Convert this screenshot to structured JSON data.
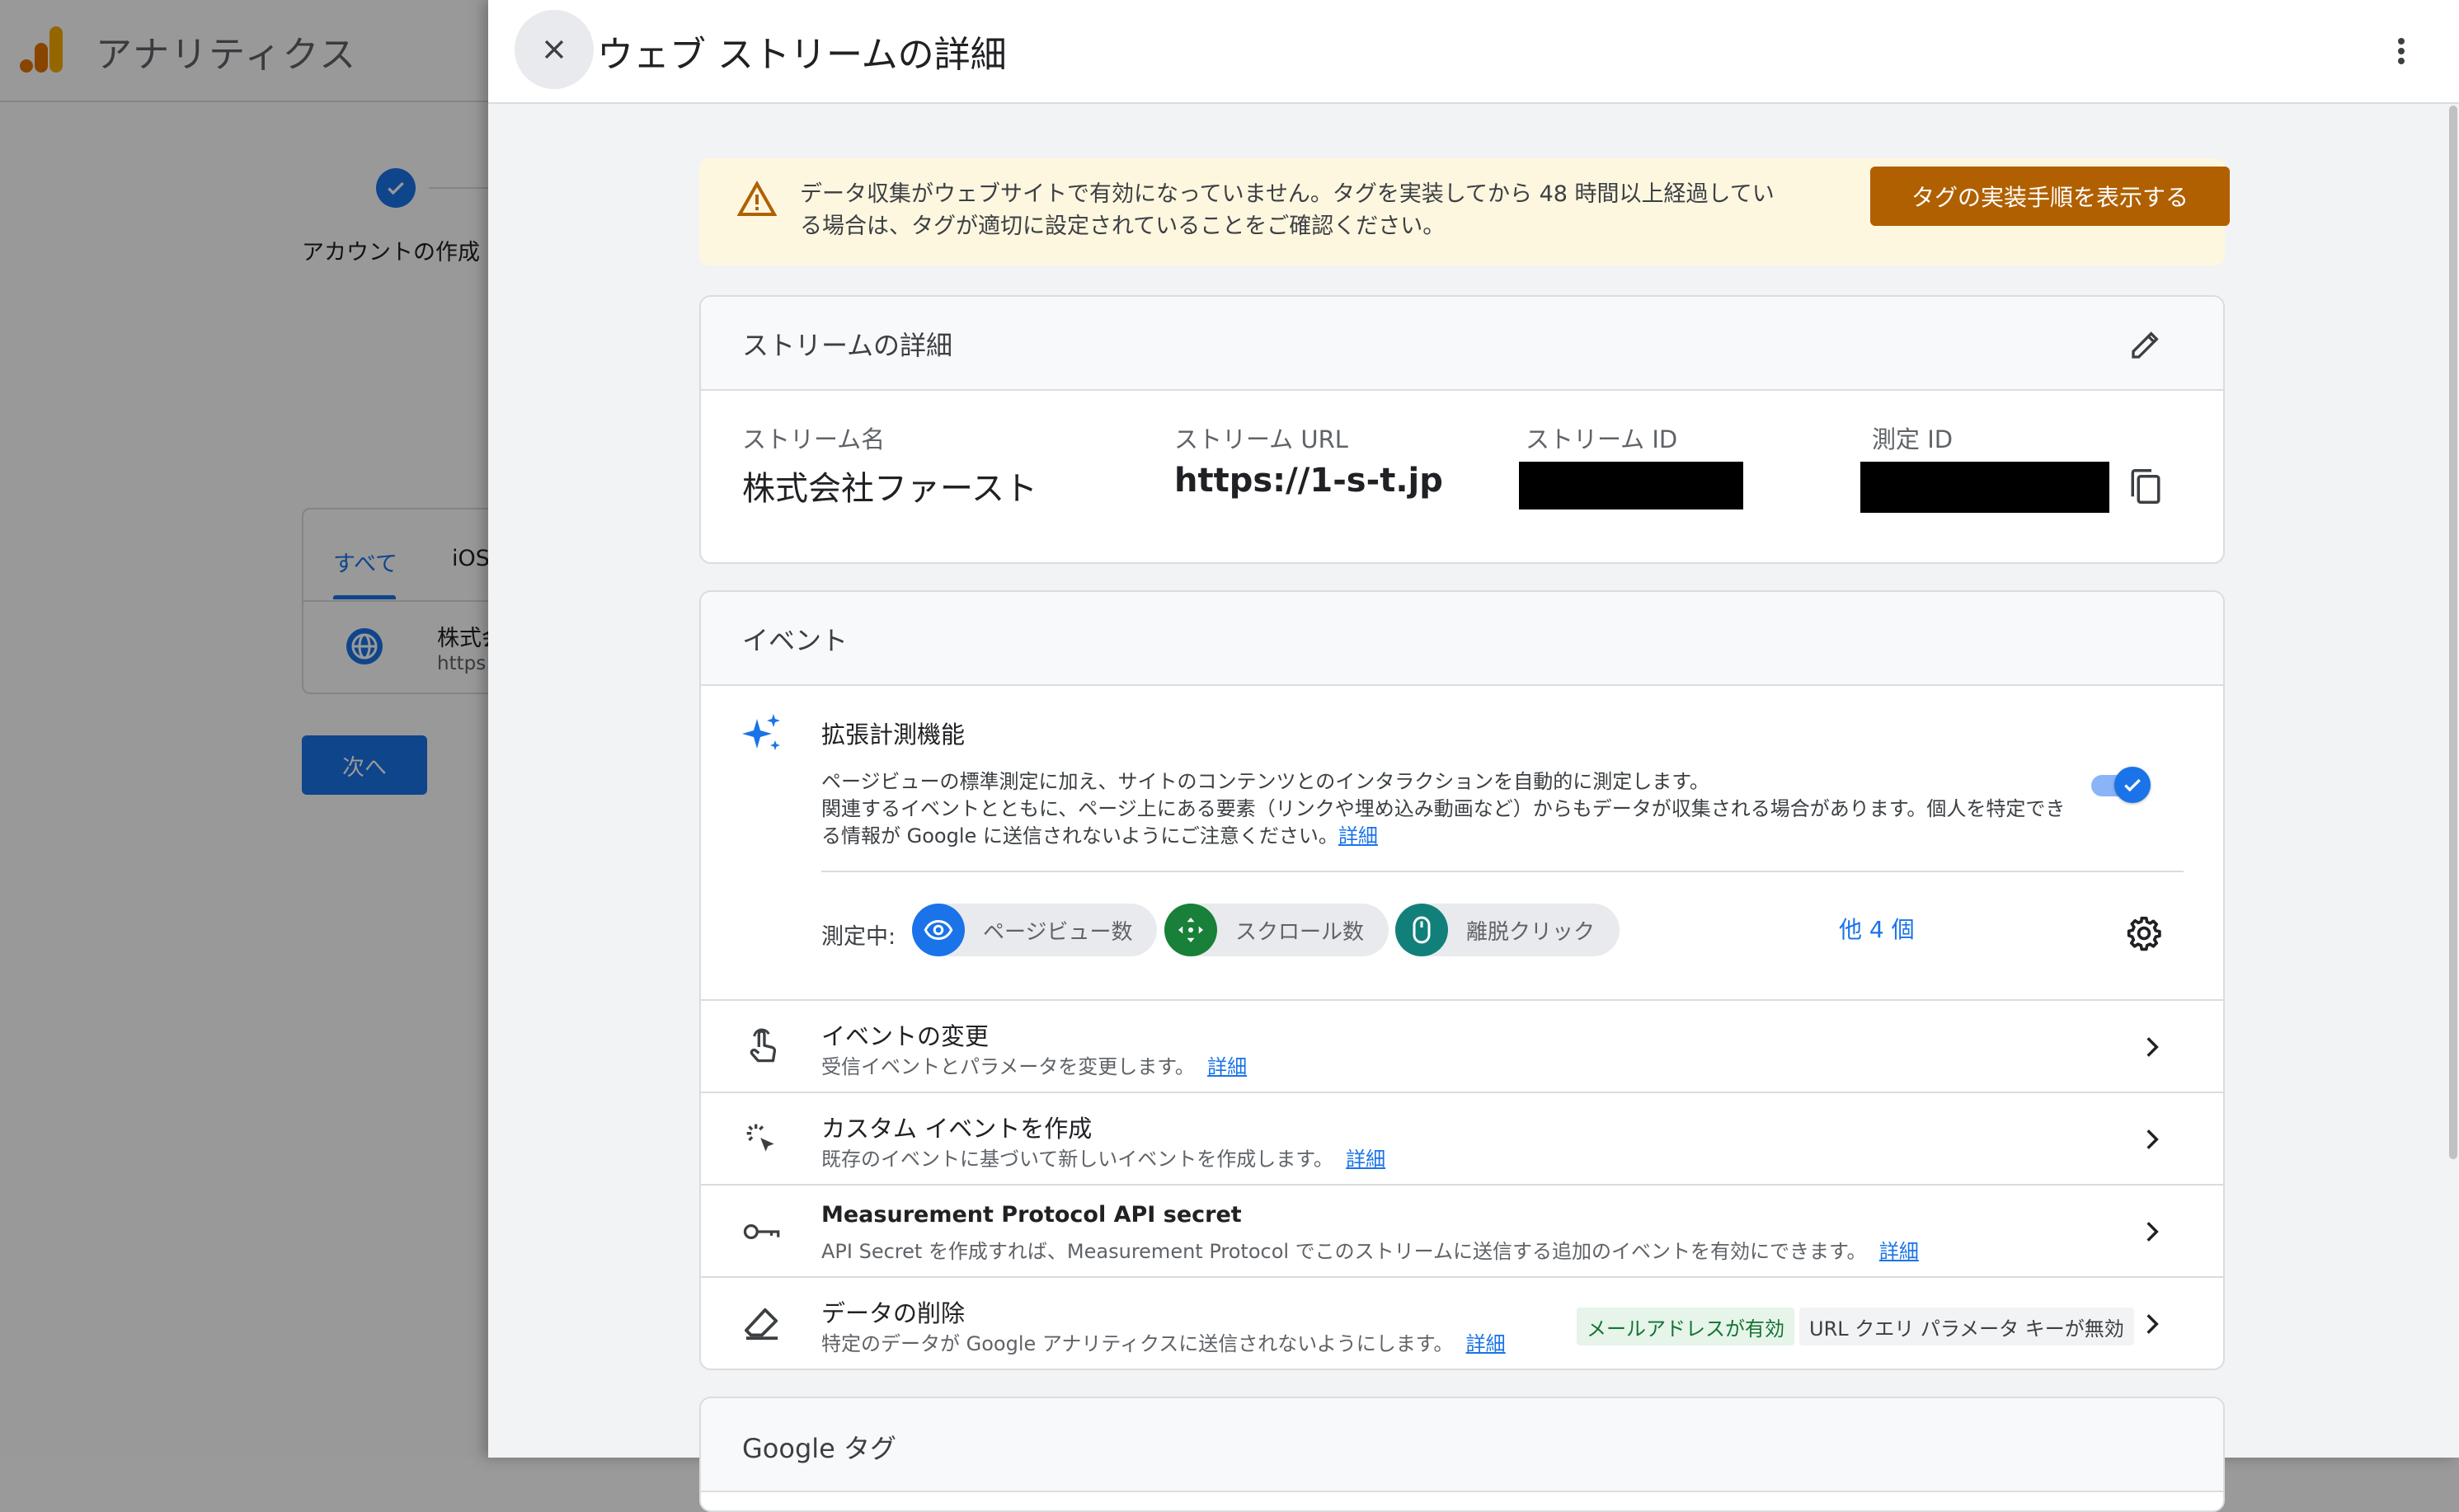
{
  "background": {
    "app_title": "アナリティクス",
    "step_label": "アカウントの作成",
    "tabs": [
      "すべて",
      "iOS"
    ],
    "row_name": "株式会",
    "row_url": "https:",
    "next_button": "次へ"
  },
  "drawer": {
    "title": "ウェブ ストリームの詳細",
    "warning": {
      "text": "データ収集がウェブサイトで有効になっていません。タグを実装してから 48 時間以上経過している場合は、タグが適切に設定されていることをご確認ください。",
      "button": "タグの実装手順を表示する"
    },
    "stream_details": {
      "heading": "ストリームの詳細",
      "name_label": "ストリーム名",
      "name_value": "株式会社ファースト",
      "url_label": "ストリーム URL",
      "url_value": "https://1-s-t.jp",
      "id_label": "ストリーム ID",
      "measurement_label": "測定 ID"
    },
    "events": {
      "heading": "イベント",
      "enhanced_title": "拡張計測機能",
      "enhanced_desc_1": "ページビューの標準測定に加え、サイトのコンテンツとのインタラクションを自動的に測定します。",
      "enhanced_desc_2": "関連するイベントとともに、ページ上にある要素（リンクや埋め込み動画など）からもデータが収集される場合があります。個人を特定できる情報が Google に送信されないようにご注意ください。",
      "details_link": "詳細",
      "enhanced_enabled": true,
      "measuring_label": "測定中:",
      "chips": [
        {
          "label": "ページビュー数",
          "icon": "eye-icon",
          "color": "#1a73e8"
        },
        {
          "label": "スクロール数",
          "icon": "scroll-arrows-icon",
          "color": "#188038"
        },
        {
          "label": "離脱クリック",
          "icon": "mouse-icon",
          "color": "#12807a"
        }
      ],
      "more_link": "他 4 個",
      "rows": [
        {
          "title": "イベントの変更",
          "desc": "受信イベントとパラメータを変更します。",
          "link": "詳細"
        },
        {
          "title": "カスタム イベントを作成",
          "desc": "既存のイベントに基づいて新しいイベントを作成します。",
          "link": "詳細"
        },
        {
          "title": "Measurement Protocol API secret",
          "desc": "API Secret を作成すれば、Measurement Protocol でこのストリームに送信する追加のイベントを有効にできます。",
          "link": "詳細"
        },
        {
          "title": "データの削除",
          "desc": "特定のデータが Google アナリティクスに送信されないようにします。",
          "link": "詳細"
        }
      ],
      "badges": {
        "email": "メールアドレスが有効",
        "url": "URL クエリ パラメータ キーが無効"
      }
    },
    "google_tag": {
      "heading": "Google タグ"
    }
  },
  "colors": {
    "accent": "#1a73e8",
    "warning_bg": "#fef7e0",
    "warning_button": "#b06000",
    "email_badge_bg": "#e6f4ea",
    "email_badge_fg": "#137333"
  }
}
